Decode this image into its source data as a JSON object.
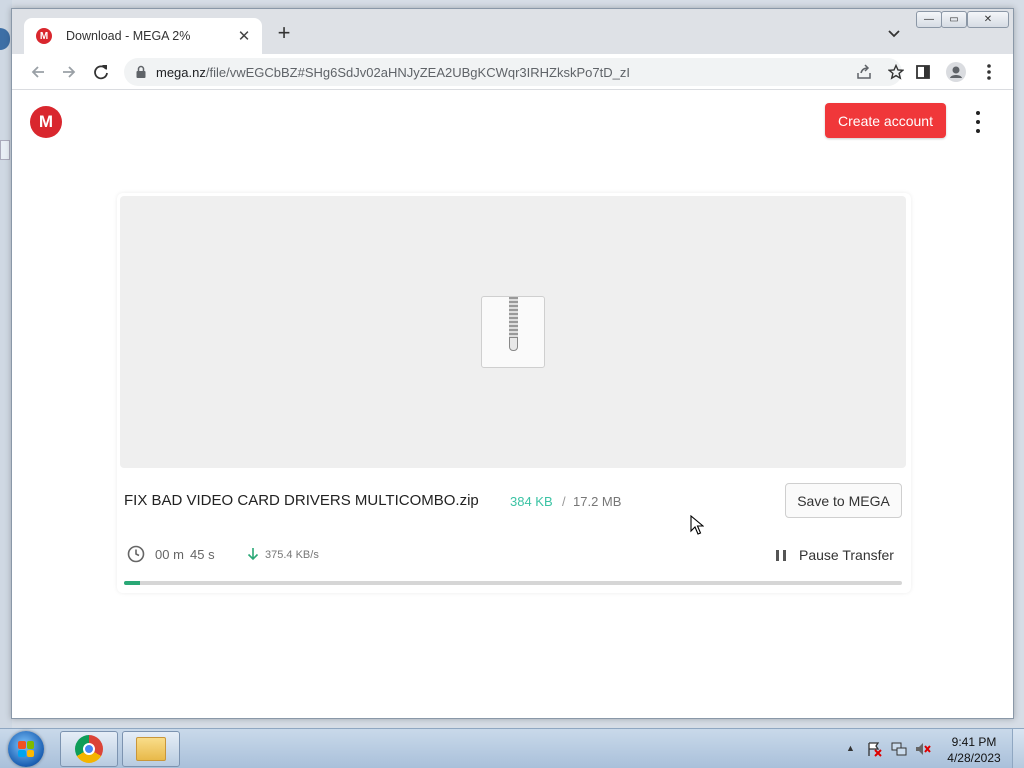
{
  "browser": {
    "tab": {
      "title": "Download - MEGA 2%",
      "favicon_letter": "M",
      "close_symbol": "✕"
    },
    "new_tab_symbol": "+",
    "address": {
      "host": "mega.nz",
      "path": "/file/vwEGCbBZ#SHg6SdJv02aHNJyZEA2UBgKCWqr3IRHZkskPo7tD_zI"
    },
    "window_controls": {
      "minimize": "—",
      "maximize": "▭",
      "close": "✕"
    }
  },
  "page": {
    "logo_letter": "M",
    "create_account_label": "Create account",
    "file": {
      "name": "FIX BAD VIDEO CARD DRIVERS MULTICOMBO.zip",
      "downloaded": "384 KB",
      "separator": "/",
      "total": "17.2 MB"
    },
    "save_button_label": "Save to MEGA",
    "transfer": {
      "time_minutes": "00 m",
      "time_seconds": "45 s",
      "speed": "375.4 KB/s",
      "pause_label": "Pause Transfer",
      "progress_percent": 2
    }
  },
  "colors": {
    "mega_red": "#d9272e",
    "create_button": "#f0373a",
    "downloaded_text": "#3cc3a4",
    "progress_fill": "#2aa876"
  },
  "taskbar": {
    "apps": [
      "windows-start",
      "google-chrome",
      "windows-explorer"
    ],
    "clock": {
      "time": "9:41 PM",
      "date": "4/28/2023"
    }
  }
}
